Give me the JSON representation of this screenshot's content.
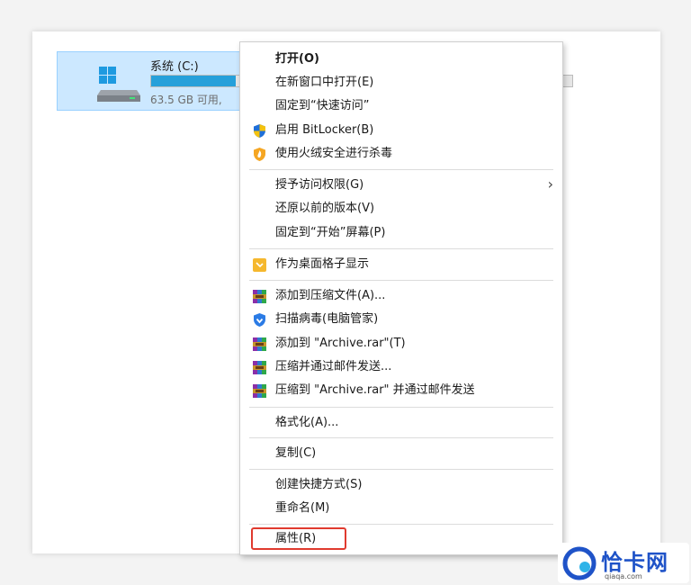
{
  "drive": {
    "name": "系统 (C:)",
    "free_text": "63.5 GB 可用,",
    "used_fraction": 0.2,
    "icon": "hard-drive-windows-icon"
  },
  "menu": {
    "items": [
      {
        "label": "打开(O)",
        "bold": true,
        "icon": null
      },
      {
        "label": "在新窗口中打开(E)",
        "icon": null
      },
      {
        "label": "固定到“快速访问”",
        "icon": null
      },
      {
        "label": "启用 BitLocker(B)",
        "icon": "uac-shield-icon"
      },
      {
        "label": "使用火绒安全进行杀毒",
        "icon": "huorong-shield-icon"
      },
      {
        "label": "授予访问权限(G)",
        "icon": null,
        "submenu": true
      },
      {
        "label": "还原以前的版本(V)",
        "icon": null
      },
      {
        "label": "固定到“开始”屏幕(P)",
        "icon": null
      },
      {
        "label": "作为桌面格子显示",
        "icon": "desktop-grid-icon"
      },
      {
        "label": "添加到压缩文件(A)...",
        "icon": "winrar-icon"
      },
      {
        "label": "扫描病毒(电脑管家)",
        "icon": "pc-manager-icon"
      },
      {
        "label": "添加到 \"Archive.rar\"(T)",
        "icon": "winrar-icon"
      },
      {
        "label": "压缩并通过邮件发送...",
        "icon": "winrar-icon"
      },
      {
        "label": "压缩到 \"Archive.rar\" 并通过邮件发送",
        "icon": "winrar-icon"
      },
      {
        "label": "格式化(A)...",
        "icon": null
      },
      {
        "label": "复制(C)",
        "icon": null
      },
      {
        "label": "创建快捷方式(S)",
        "icon": null
      },
      {
        "label": "重命名(M)",
        "icon": null
      },
      {
        "label": "属性(R)",
        "icon": null,
        "highlighted": true
      }
    ]
  },
  "watermark": {
    "title": "恰卡网",
    "url": "qiaqa.com"
  },
  "colors": {
    "selection_bg": "#cce8ff",
    "highlight_border": "#e03a2f",
    "progress_fill": "#26a0da",
    "watermark_blue": "#1f53c8"
  }
}
